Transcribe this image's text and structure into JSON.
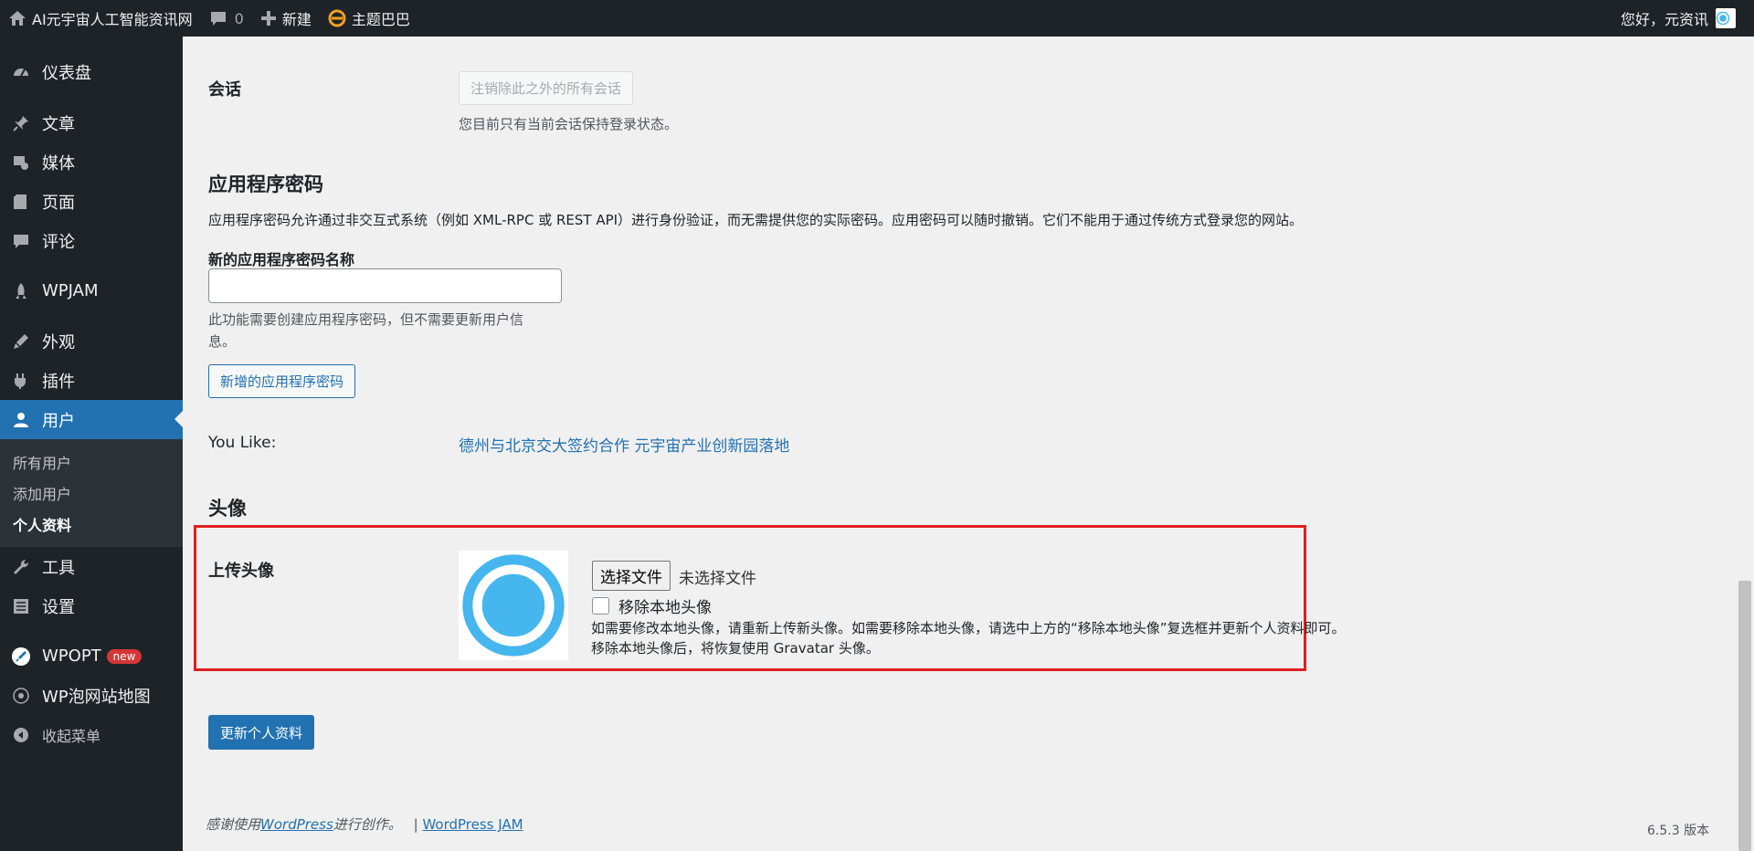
{
  "adminbar": {
    "site_name": "AI元宇宙人工智能资讯网",
    "comments_count": "0",
    "new_label": "新建",
    "theme_label": "主题巴巴",
    "greeting": "您好，元资讯"
  },
  "sidebar": {
    "items": [
      {
        "label": "仪表盘"
      },
      {
        "label": "文章"
      },
      {
        "label": "媒体"
      },
      {
        "label": "页面"
      },
      {
        "label": "评论"
      },
      {
        "label": "WPJAM"
      },
      {
        "label": "外观"
      },
      {
        "label": "插件"
      },
      {
        "label": "用户"
      },
      {
        "label": "工具"
      },
      {
        "label": "设置"
      },
      {
        "label": "WPOPT"
      },
      {
        "label": "WP泡网站地图"
      },
      {
        "label": "收起菜单"
      }
    ],
    "submenu": [
      "所有用户",
      "添加用户",
      "个人资料"
    ],
    "badge_new": "new"
  },
  "sessions": {
    "label": "会话",
    "button": "注销除此之外的所有会话",
    "desc": "您目前只有当前会话保持登录状态。"
  },
  "app_passwords": {
    "title": "应用程序密码",
    "desc": "应用程序密码允许通过非交互式系统（例如 XML-RPC 或 REST API）进行身份验证，而无需提供您的实际密码。应用密码可以随时撤销。它们不能用于通过传统方式登录您的网站。",
    "field_label": "新的应用程序密码名称",
    "field_value": "",
    "help_line1": "此功能需要创建应用程序密码，但不需要更新用户信",
    "help_line2": "息。",
    "add_button": "新增的应用程序密码"
  },
  "you_like": {
    "label": "You Like:",
    "link": "德州与北京交大签约合作 元宇宙产业创新园落地"
  },
  "avatar": {
    "title": "头像",
    "upload_label": "上传头像",
    "choose_file": "选择文件",
    "no_file": "未选择文件",
    "remove_label": "移除本地头像",
    "remove_checked": false,
    "help_line1": "如需要修改本地头像，请重新上传新头像。如需要移除本地头像，请选中上方的“移除本地头像”复选框并更新个人资料即可。",
    "help_line2": "移除本地头像后，将恢复使用 Gravatar 头像。",
    "logo_color": "#45b6ee"
  },
  "submit": {
    "label": "更新个人资料"
  },
  "footer": {
    "thanks_prefix": "感谢使用",
    "wp_link": "WordPress",
    "thanks_suffix": "进行创作。",
    "separator": "|",
    "jam_link": "WordPress JAM",
    "version": "6.5.3 版本"
  },
  "colors": {
    "accent": "#2271b1",
    "highlight_border": "#e02020",
    "adminbar_bg": "#1d2327"
  }
}
